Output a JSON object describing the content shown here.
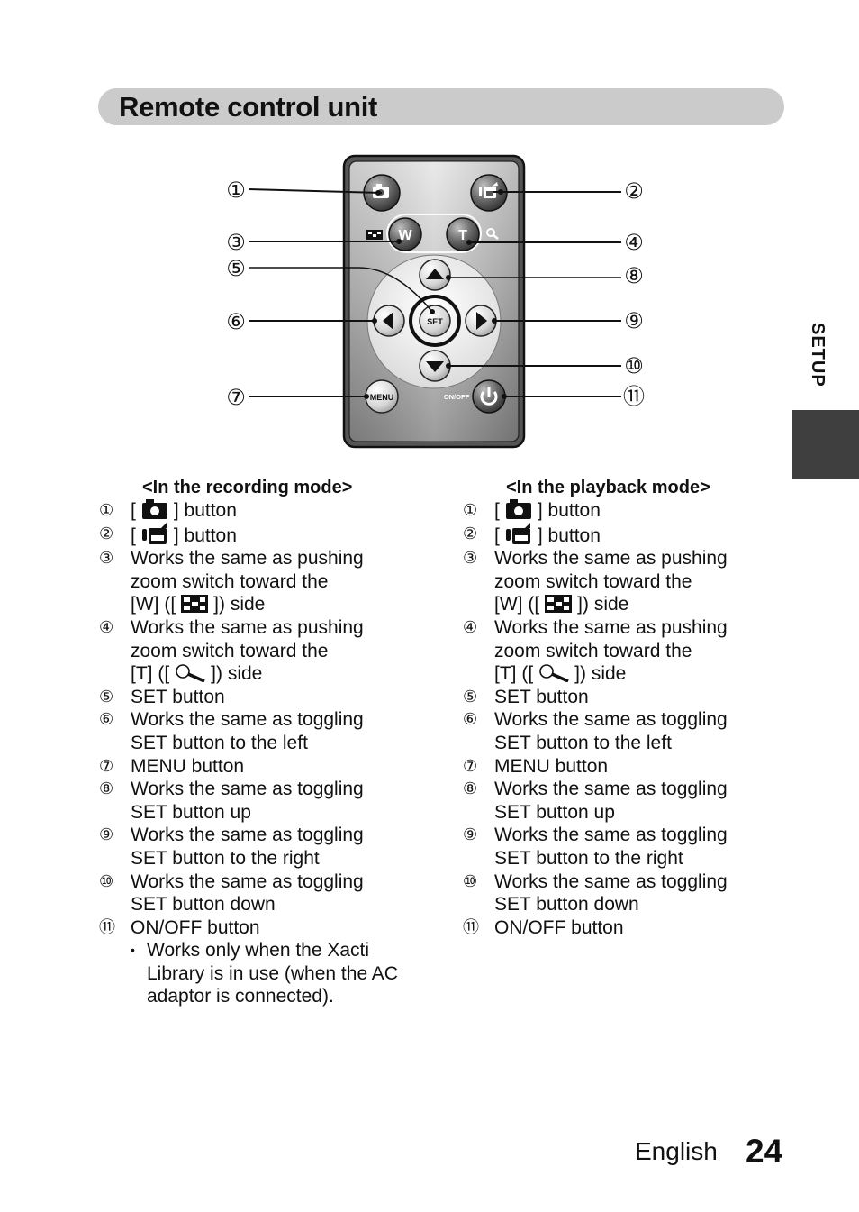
{
  "page": {
    "title": "Remote control unit",
    "section_tab": "SETUP",
    "footer": {
      "language": "English",
      "page_number": "24"
    }
  },
  "diagram": {
    "buttons": {
      "photo": "camera-icon",
      "video": "video-camera-icon",
      "wide": "W",
      "tele": "T",
      "set": "SET",
      "menu": "MENU",
      "onoff_label": "ON/OFF",
      "power": "power-icon"
    },
    "callouts_left": [
      "①",
      "③",
      "⑤",
      "⑥",
      "⑦"
    ],
    "callouts_right": [
      "②",
      "④",
      "⑧",
      "⑨",
      "⑩",
      "⑪"
    ]
  },
  "recording_mode": {
    "heading": "<In the recording mode>",
    "items": [
      {
        "num": "1",
        "lines": [
          "[ {camera} ] button"
        ]
      },
      {
        "num": "2",
        "lines": [
          "[ {video} ] button"
        ]
      },
      {
        "num": "3",
        "lines": [
          "Works the same as pushing",
          "zoom switch toward the",
          "[W] ([ {wide} ]) side"
        ]
      },
      {
        "num": "4",
        "lines": [
          "Works the same as pushing",
          "zoom switch toward the",
          "[T] ([ {tele} ]) side"
        ]
      },
      {
        "num": "5",
        "lines": [
          "SET button"
        ]
      },
      {
        "num": "6",
        "lines": [
          "Works the same as toggling",
          "SET button to the left"
        ]
      },
      {
        "num": "7",
        "lines": [
          "MENU button"
        ]
      },
      {
        "num": "8",
        "lines": [
          "Works the same as toggling",
          "SET button up"
        ]
      },
      {
        "num": "9",
        "lines": [
          "Works the same as toggling",
          "SET button to the right"
        ]
      },
      {
        "num": "10",
        "lines": [
          "Works the same as toggling",
          "SET button down"
        ]
      },
      {
        "num": "11",
        "lines": [
          "ON/OFF button"
        ]
      }
    ],
    "note": [
      "Works only when the Xacti",
      "Library is in use (when the AC",
      "adaptor is connected)."
    ]
  },
  "playback_mode": {
    "heading": "<In the playback mode>",
    "items": [
      {
        "num": "1",
        "lines": [
          "[ {camera} ] button"
        ]
      },
      {
        "num": "2",
        "lines": [
          "[ {video} ] button"
        ]
      },
      {
        "num": "3",
        "lines": [
          "Works the same as pushing",
          "zoom switch toward the",
          "[W] ([ {wide} ]) side"
        ]
      },
      {
        "num": "4",
        "lines": [
          "Works the same as pushing",
          "zoom switch toward the",
          "[T] ([ {tele} ]) side"
        ]
      },
      {
        "num": "5",
        "lines": [
          "SET button"
        ]
      },
      {
        "num": "6",
        "lines": [
          "Works the same as toggling",
          "SET button to the left"
        ]
      },
      {
        "num": "7",
        "lines": [
          "MENU button"
        ]
      },
      {
        "num": "8",
        "lines": [
          "Works the same as toggling",
          "SET button up"
        ]
      },
      {
        "num": "9",
        "lines": [
          "Works the same as toggling",
          "SET button to the right"
        ]
      },
      {
        "num": "10",
        "lines": [
          "Works the same as toggling",
          "SET button down"
        ]
      },
      {
        "num": "11",
        "lines": [
          "ON/OFF button"
        ]
      }
    ]
  }
}
